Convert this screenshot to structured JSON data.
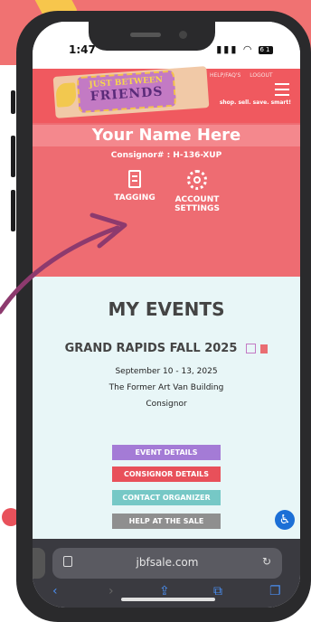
{
  "status": {
    "time": "1:47",
    "battery": "61"
  },
  "header": {
    "logo_line1": "JUST BETWEEN",
    "logo_line2": "FRIENDS",
    "help_link": "HELP/FAQ'S",
    "logout_link": "LOGOUT",
    "tagline": "shop. sell. save. smart!",
    "menu_icon": "hamburger-menu-icon"
  },
  "panel": {
    "name": "Your Name Here",
    "consignor": "Consignor# : H-136-XUP",
    "tagging_label": "TAGGING",
    "account_label_1": "ACCOUNT",
    "account_label_2": "SETTINGS"
  },
  "events": {
    "heading": "MY EVENTS",
    "title": "GRAND RAPIDS FALL 2025",
    "dates": "September 10 - 13, 2025",
    "venue": "The Former Art Van Building",
    "role": "Consignor"
  },
  "buttons": {
    "event_details": "EVENT DETAILS",
    "consignor_details": "CONSIGNOR DETAILS",
    "contact_organizer": "CONTACT ORGANIZER",
    "help_at_sale": "HELP AT THE SALE"
  },
  "browser": {
    "url": "jbfsale.com"
  },
  "colors": {
    "header_red": "#f0595f",
    "panel_red": "#ee6c72",
    "content_bg": "#e8f6f7",
    "purple": "#a47bd6",
    "red_button": "#e8505a",
    "teal": "#76c8c6",
    "gray": "#8f8f8f",
    "arrow": "#8d3a6e"
  }
}
